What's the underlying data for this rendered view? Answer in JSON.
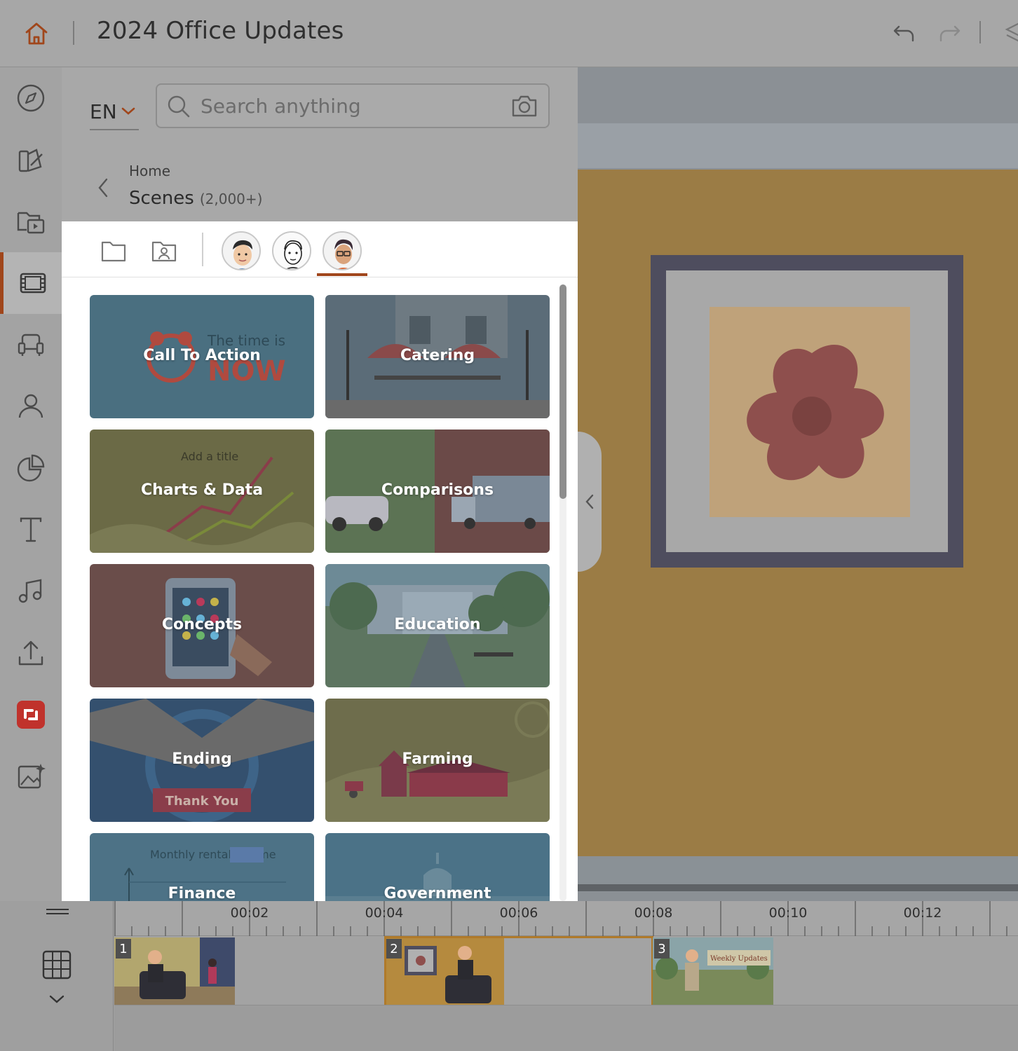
{
  "app": {
    "doc_title": "2024 Office Updates"
  },
  "panel": {
    "language": "EN",
    "search_placeholder": "Search anything",
    "breadcrumb_home": "Home",
    "section_title": "Scenes",
    "section_count": "(2,000+)"
  },
  "categories": [
    {
      "label": "Call To Action",
      "color": "#4a6f80"
    },
    {
      "label": "Catering",
      "color": "#5b6c78"
    },
    {
      "label": "Charts & Data",
      "color": "#6b6a46"
    },
    {
      "label": "Comparisons",
      "color": "#5c7354"
    },
    {
      "label": "Concepts",
      "color": "#6a4d4a"
    },
    {
      "label": "Education",
      "color": "#5d7560"
    },
    {
      "label": "Ending",
      "color": "#34506e"
    },
    {
      "label": "Farming",
      "color": "#6e6d4c"
    },
    {
      "label": "Finance",
      "color": "#4d7286"
    },
    {
      "label": "Government",
      "color": "#4b7287"
    }
  ],
  "timeline": {
    "ruler": [
      "00:02",
      "00:04",
      "00:06",
      "00:08",
      "00:10",
      "00:12"
    ],
    "clips": [
      {
        "num": "1",
        "banner": ""
      },
      {
        "num": "2",
        "banner": ""
      },
      {
        "num": "3",
        "banner": "Weekly Updates"
      }
    ]
  },
  "colors": {
    "accent": "#a0461b",
    "canvas": "#9b7c45",
    "selected_clip": "#b07a2a"
  }
}
